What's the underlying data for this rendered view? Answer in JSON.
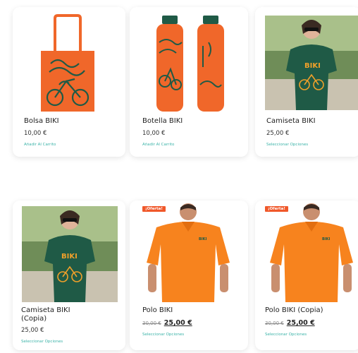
{
  "products": [
    {
      "title": "Bolsa BIKI",
      "price": "10,00 €",
      "action": "Añadir Al Carrito"
    },
    {
      "title": "Botella BIKI",
      "price": "10,00 €",
      "action": "Añadir Al Carrito"
    },
    {
      "title": "Camiseta BIKI",
      "price": "25,00 €",
      "action": "Seleccionar Opciones"
    },
    {
      "title_line1": "Camiseta BIKI",
      "title_line2": "(Copia)",
      "price": "25,00 €",
      "action": "Seleccionar Opciones"
    },
    {
      "title": "Polo BIKI",
      "badge": "¡Oferta!",
      "old_price": "30,00 €",
      "price": "25,00 €",
      "action": "Seleccionar Opciones"
    },
    {
      "title": "Polo BIKI (Copia)",
      "badge": "¡Oferta!",
      "old_price": "30,00 €",
      "price": "25,00 €",
      "action": "Seleccionar Opciones"
    }
  ],
  "brand_mark": "BIKI",
  "colors": {
    "orange": "#f0672a",
    "green": "#1f5a46",
    "teal": "#3bb3a8",
    "badge": "#f0582a"
  }
}
